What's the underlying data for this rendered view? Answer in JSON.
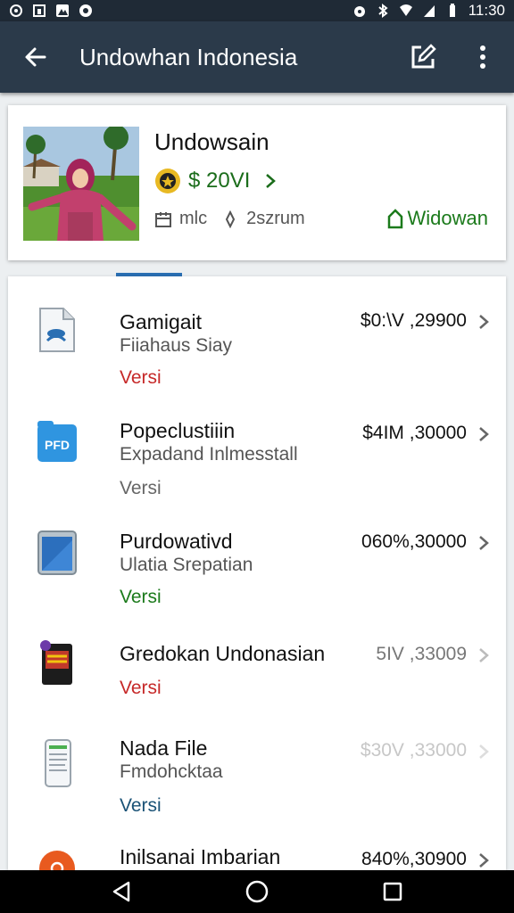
{
  "status_bar": {
    "time": "11:30",
    "left_icons": [
      "settings-icon",
      "bag-icon",
      "mountain-icon",
      "record-icon"
    ],
    "right_icons": [
      "alarm-icon",
      "bluetooth-icon",
      "wifi-icon",
      "signal-icon",
      "battery-icon"
    ]
  },
  "app_bar": {
    "title": "Undowhan Indonesia",
    "back_icon": "arrow-back-icon",
    "edit_icon": "edit-icon",
    "more_icon": "more-vert-icon"
  },
  "profile_card": {
    "name": "Undowsain",
    "price": "$ 20VI",
    "meta_left": "mlc",
    "meta_right": "2szrum",
    "badge": "Widowan",
    "colors": {
      "price": "#1b6d1b",
      "badge": "#1b7a1b"
    }
  },
  "list": {
    "items": [
      {
        "title": "Gamigait",
        "subtitle": "Fiiahaus Siay",
        "tag": "Versi",
        "tag_color": "#c62828",
        "amount": "$0:\\V ,29900",
        "icon": "document-icon"
      },
      {
        "title": "Popeclustiiin",
        "subtitle": "Expadand Inlmesstall",
        "tag": "Versi",
        "tag_color": "#666666",
        "amount": "$4IM ,30000",
        "icon": "folder-icon"
      },
      {
        "title": "Purdowativd",
        "subtitle": "Ulatia Srepatian",
        "tag": "Versi",
        "tag_color": "#1b7a1b",
        "amount": "060%,30000",
        "icon": "tablet-icon"
      },
      {
        "title": "Gredokan Undonasian",
        "subtitle": "",
        "tag": "Versi",
        "tag_color": "#c62828",
        "amount": "5IV ,33009",
        "icon": "app-box-icon"
      },
      {
        "title": "Nada File",
        "subtitle": "Fmdohcktaa",
        "tag": "Versi",
        "tag_color": "#1a5276",
        "amount": "$30V ,33000",
        "icon": "phone-doc-icon"
      },
      {
        "title": "Inilsanai Imbarian",
        "subtitle": "",
        "tag": "",
        "tag_color": "#666666",
        "amount": "840%,30900",
        "icon": "orange-circle-icon"
      }
    ]
  },
  "nav_bar": {
    "back": "nav-back-icon",
    "home": "nav-home-icon",
    "recents": "nav-recents-icon"
  }
}
